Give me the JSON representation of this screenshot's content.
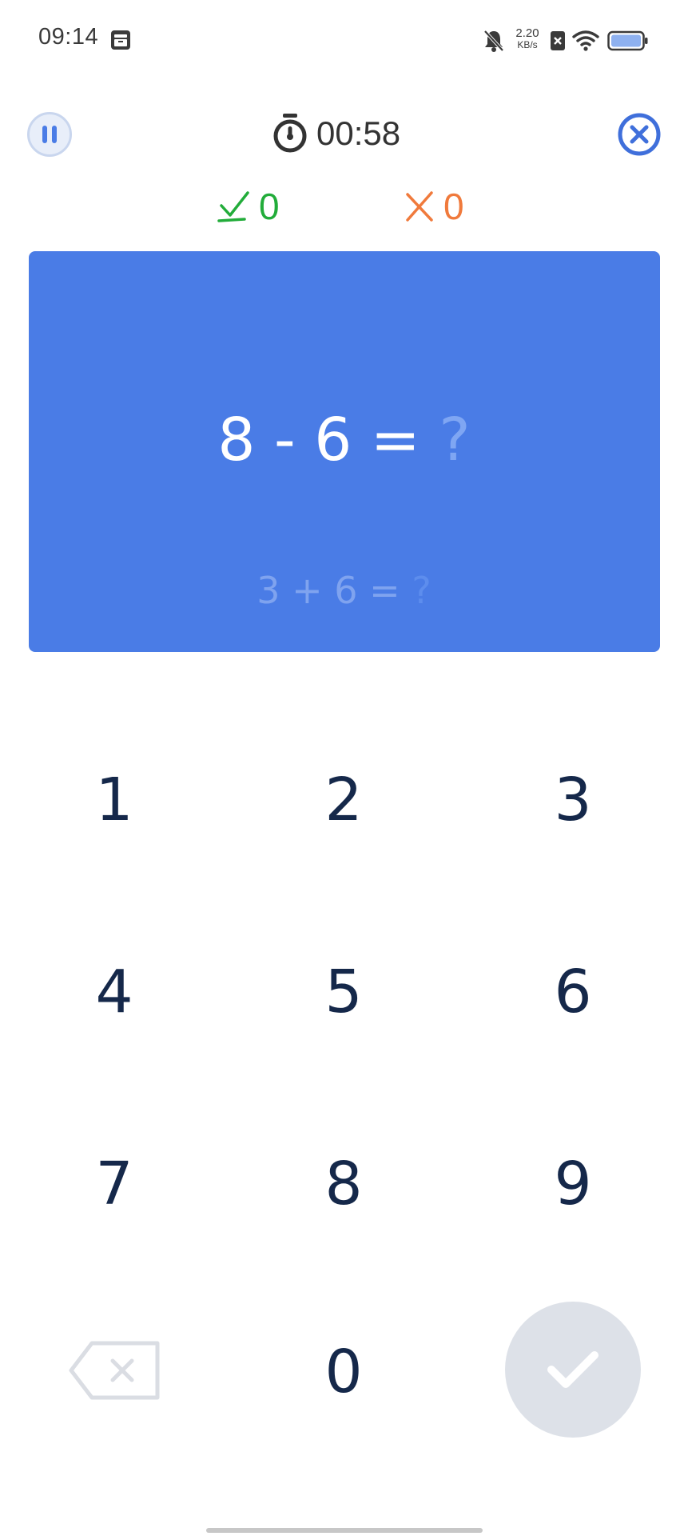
{
  "status_bar": {
    "time": "09:14",
    "net_speed_value": "2.20",
    "net_speed_unit": "KB/s"
  },
  "timer": {
    "value": "00:58"
  },
  "score": {
    "correct": "0",
    "wrong": "0"
  },
  "question": {
    "current_expr": "8 - 6 = ",
    "current_placeholder": "?",
    "next_expr": "3 + 6 = ",
    "next_placeholder": "?"
  },
  "keypad": {
    "keys": [
      "1",
      "2",
      "3",
      "4",
      "5",
      "6",
      "7",
      "8",
      "9",
      "0"
    ]
  },
  "colors": {
    "card": "#4a7ce6",
    "correct": "#22ac3a",
    "wrong": "#f07a3c",
    "key_text": "#15284a",
    "submit_bg": "#dde1e8"
  },
  "icons": {
    "pause": "pause-icon",
    "stopwatch": "stopwatch-icon",
    "close": "close-icon",
    "check": "check-icon",
    "cross": "cross-icon",
    "backspace": "backspace-icon",
    "submit": "check-icon"
  }
}
